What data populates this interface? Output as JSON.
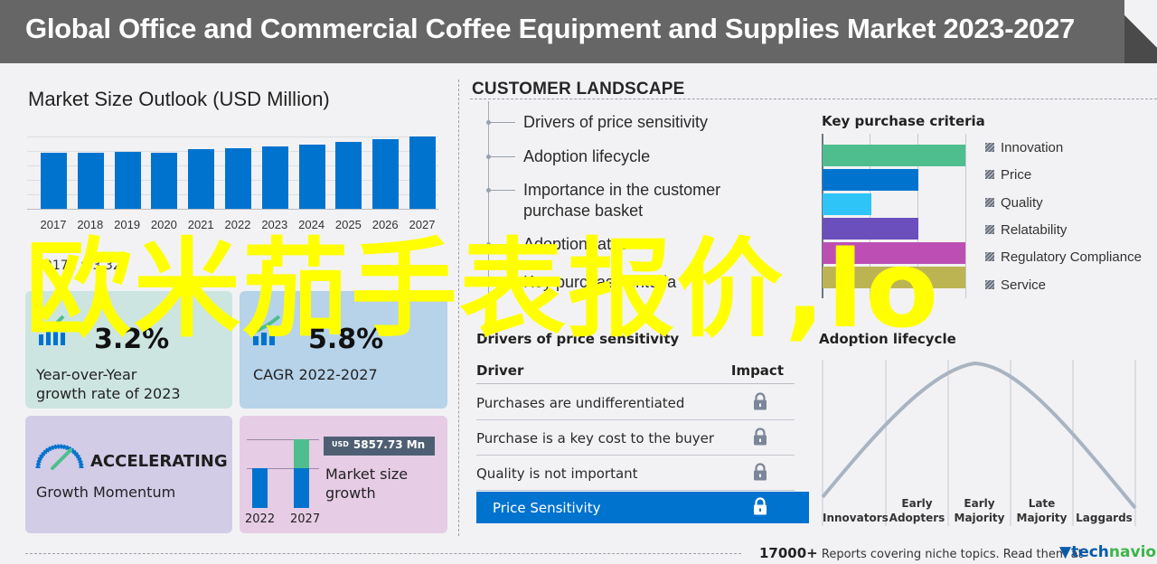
{
  "banner": {
    "title": "Global Office and Commercial Coffee Equipment and Supplies Market 2023-2027"
  },
  "market_size": {
    "title": "Market Size Outlook (USD Million)",
    "years": [
      "2017",
      "2018",
      "2019",
      "2020",
      "2021",
      "2022",
      "2023",
      "2024",
      "2025",
      "2026",
      "2027"
    ],
    "relative_values": [
      0.77,
      0.78,
      0.79,
      0.77,
      0.82,
      0.84,
      0.86,
      0.89,
      0.93,
      0.96,
      1.0
    ],
    "bar_color": "#0073cf",
    "note": "2017 : $ 3.32"
  },
  "cards": {
    "yoy": {
      "value": "3.2%",
      "label_line1": "Year-over-Year",
      "label_line2": "growth rate of 2023",
      "icon": "bar-growth-icon"
    },
    "cagr": {
      "value": "5.8%",
      "label": "CAGR  2022-2027",
      "icon": "bar-growth-icon"
    },
    "momentum": {
      "value": "ACCELERATING",
      "label": "Growth Momentum",
      "icon": "speedometer-icon"
    },
    "market_growth": {
      "currency": "USD",
      "value": "5857.73 Mn",
      "label_line1": "Market size",
      "label_line2": "growth",
      "year_start": "2022",
      "year_end": "2027"
    }
  },
  "customer_landscape": {
    "title": "CUSTOMER  LANDSCAPE",
    "items": [
      {
        "line1": "Drivers of price sensitivity"
      },
      {
        "line1": "Adoption lifecycle"
      },
      {
        "line1": "Importance in the customer",
        "line2": "purchase basket"
      },
      {
        "line1": "Adoption rates"
      },
      {
        "line1": "Key purchase criteria"
      }
    ]
  },
  "key_purchase_criteria": {
    "title": "Key purchase criteria",
    "criteria": [
      {
        "name": "Innovation",
        "level": 1.0,
        "color": "#4fbe8e"
      },
      {
        "name": "Price",
        "level": 0.67,
        "color": "#0073cf"
      },
      {
        "name": "Quality",
        "level": 0.34,
        "color": "#2ec4f7"
      },
      {
        "name": "Relatability",
        "level": 0.67,
        "color": "#6a4fbd"
      },
      {
        "name": "Regulatory Compliance",
        "level": 1.0,
        "color": "#bd4fb4"
      },
      {
        "name": "Service",
        "level": 1.0,
        "color": "#bcb453"
      }
    ]
  },
  "drivers": {
    "title": "Drivers of price sensitivity",
    "col_driver": "Driver",
    "col_impact": "Impact",
    "rows": [
      {
        "driver": "Purchases are undifferentiated",
        "impact": "locked"
      },
      {
        "driver": "Purchase is a key cost to the buyer",
        "impact": "locked"
      },
      {
        "driver": "Quality is not important",
        "impact": "locked"
      }
    ],
    "summary": {
      "label": "Price Sensitivity",
      "impact": "locked"
    },
    "highlight_color": "#0073cf"
  },
  "adoption": {
    "title": "Adoption lifecycle",
    "stages": [
      {
        "line1": "",
        "line2": "Innovators"
      },
      {
        "line1": "Early",
        "line2": "Adopters"
      },
      {
        "line1": "Early",
        "line2": "Majority"
      },
      {
        "line1": "Late",
        "line2": "Majority"
      },
      {
        "line1": "",
        "line2": "Laggards"
      }
    ]
  },
  "footer": {
    "count": "17000+",
    "text": "Reports covering niche topics. Read them at",
    "brand_part1": "tech",
    "brand_part2": "navio"
  },
  "overlay": {
    "text": "欧米茄手表报价,lo"
  }
}
